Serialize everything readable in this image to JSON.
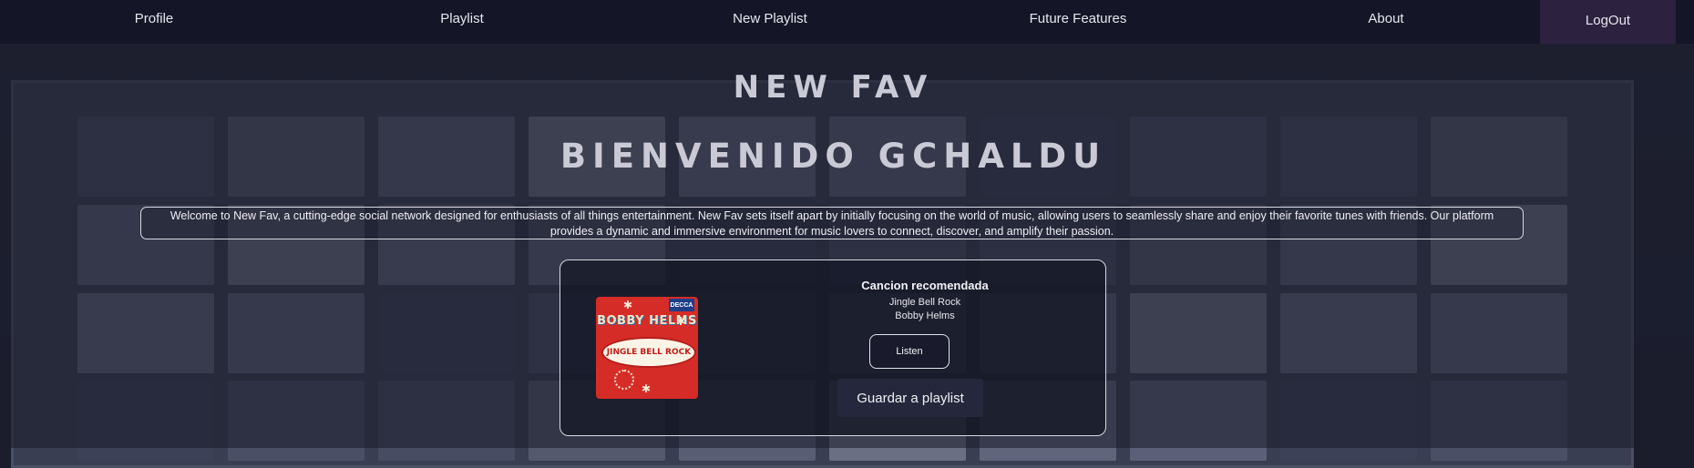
{
  "nav": {
    "items": [
      {
        "label": "Profile"
      },
      {
        "label": "Playlist"
      },
      {
        "label": "New Playlist"
      },
      {
        "label": "Future Features"
      },
      {
        "label": "About"
      }
    ],
    "logout_label": "LogOut"
  },
  "header": {
    "title": "NEW FAV",
    "welcome": "BIENVENIDO GCHALDU"
  },
  "intro": {
    "text": "Welcome to New Fav, a cutting-edge social network designed for enthusiasts of all things entertainment. New Fav sets itself apart by initially focusing on the world of music, allowing users to seamlessly share and enjoy their favorite tunes with friends. Our platform provides a dynamic and immersive environment for music lovers to connect, discover, and amplify their passion."
  },
  "recommendation": {
    "heading": "Cancion recomendada",
    "song": "Jingle Bell Rock",
    "artist": "Bobby Helms",
    "listen_label": "Listen",
    "save_label": "Guardar a playlist",
    "cover": {
      "artist_text": "BOBBY HELMS",
      "title_text": "JINGLE BELL ROCK",
      "badge_text": "DECCA",
      "color": "#d62c27"
    }
  },
  "colors": {
    "nav_bg": "#141627",
    "logout_bg": "#2d2140",
    "page_bg": "#1b1d2c",
    "heading": "#c9cad6"
  }
}
